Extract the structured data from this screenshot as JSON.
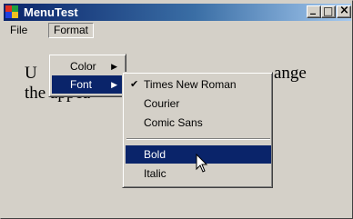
{
  "window": {
    "title": "MenuTest",
    "minimize_glyph": "_",
    "maximize_glyph": "□",
    "close_glyph": "×"
  },
  "menubar": {
    "file_label": "File",
    "format_label": "Format"
  },
  "content": {
    "line1_start": "U",
    "line1_end": "ange",
    "line2_start": "the appea"
  },
  "format_menu": {
    "color_label": "Color",
    "font_label": "Font",
    "submenu_arrow": "▶"
  },
  "font_menu": {
    "check_glyph": "✔",
    "items": [
      "Times New Roman",
      "Courier",
      "Comic Sans",
      "Bold",
      "Italic"
    ]
  }
}
